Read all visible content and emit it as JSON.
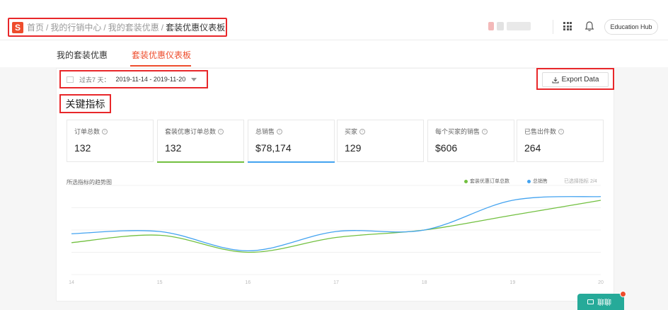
{
  "header": {
    "logo": "S",
    "breadcrumbs": [
      "首页",
      "我的行销中心",
      "我的套装优惠",
      "套装优惠仪表板"
    ],
    "separator": "/",
    "edu_hub": "Education Hub"
  },
  "tabs": [
    {
      "label": "我的套装优惠",
      "active": false
    },
    {
      "label": "套装优惠仪表板",
      "active": true
    }
  ],
  "date_filter": {
    "label": "过去7 天：",
    "range": "2019-11-14 - 2019-11-20"
  },
  "export": {
    "label": "Export Data"
  },
  "kpi_title": "关键指标",
  "kpis": [
    {
      "label": "订单总数",
      "value": "132",
      "selected": false,
      "color": ""
    },
    {
      "label": "套装优惠订单总数",
      "value": "132",
      "selected": true,
      "color": "#72c040"
    },
    {
      "label": "总销售",
      "value": "$78,174",
      "selected": true,
      "color": "#43a3f0"
    },
    {
      "label": "买家",
      "value": "129",
      "selected": false,
      "color": ""
    },
    {
      "label": "每个买家的销售",
      "value": "$606",
      "selected": false,
      "color": ""
    },
    {
      "label": "已售出件数",
      "value": "264",
      "selected": false,
      "color": ""
    }
  ],
  "chart": {
    "title": "所选指标的趋势图",
    "legend_extra": "已选择指标 2/4"
  },
  "chart_data": {
    "type": "line",
    "x": [
      "14",
      "15",
      "16",
      "17",
      "18",
      "19",
      "20"
    ],
    "series": [
      {
        "name": "套装优惠订单总数",
        "color": "#72c040",
        "values": [
          0.43,
          0.53,
          0.3,
          0.5,
          0.6,
          0.8,
          1.0
        ]
      },
      {
        "name": "总销售",
        "color": "#43a3f0",
        "values": [
          0.55,
          0.58,
          0.32,
          0.58,
          0.6,
          1.0,
          1.05
        ]
      }
    ],
    "ylim": [
      0,
      1.2
    ],
    "grid": true
  },
  "chat": {
    "label": "聊聊"
  },
  "colors": {
    "accent": "#ee4d2d",
    "highlight": "#e8272a"
  }
}
